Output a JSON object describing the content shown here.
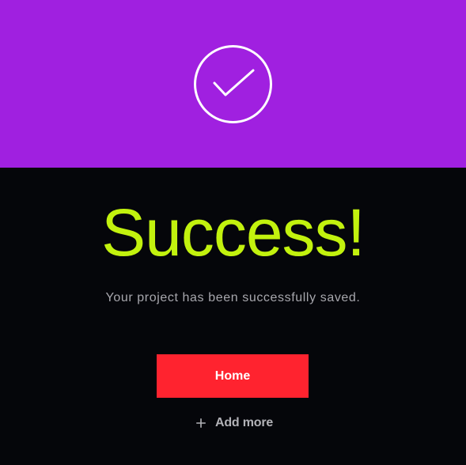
{
  "hero": {
    "background_color": "#a020e0",
    "icon": "check-circle-icon",
    "icon_color": "#ffffff"
  },
  "main": {
    "title": "Success!",
    "title_color": "#c2f20e",
    "message": "Your project has been successfully saved.",
    "message_color": "#a7a7ad",
    "background_color": "#05060a"
  },
  "actions": {
    "primary": {
      "label": "Home",
      "background_color": "#ff232f",
      "text_color": "#ffffff"
    },
    "secondary": {
      "label": "Add more",
      "icon": "plus-icon",
      "text_color": "#b2b2b7"
    }
  }
}
